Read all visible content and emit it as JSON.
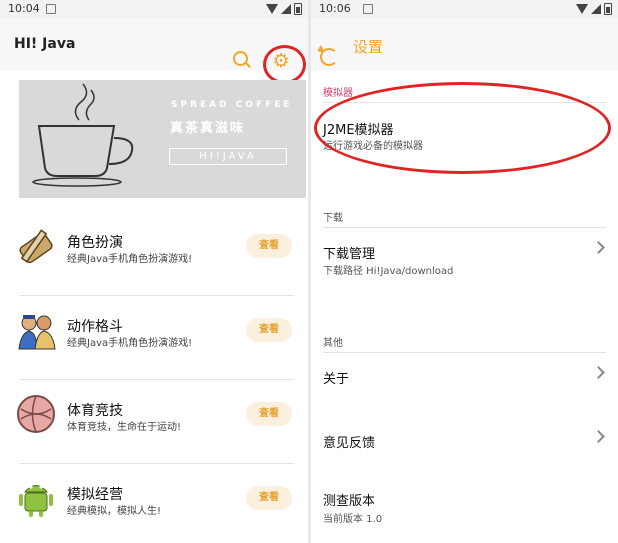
{
  "left": {
    "status": {
      "time": "10:04"
    },
    "appbar": {
      "title": "HI! Java",
      "search_icon": "search-icon",
      "settings_icon": "gear-icon"
    },
    "banner": {
      "line1": "SPREAD COFFEE",
      "line2": "真茶真滋味",
      "line3": "HI!JAVA"
    },
    "games": [
      {
        "name": "角色扮演",
        "desc": "经典Java手机角色扮演游戏!",
        "button": "查看"
      },
      {
        "name": "动作格斗",
        "desc": "经典Java手机角色扮演游戏!",
        "button": "查看"
      },
      {
        "name": "体育竞技",
        "desc": "体育竞技，生命在于运动!",
        "button": "查看"
      },
      {
        "name": "模拟经营",
        "desc": "经典模拟，模拟人生!",
        "button": "查看"
      }
    ]
  },
  "right": {
    "status": {
      "time": "10:06"
    },
    "appbar": {
      "title": "设置",
      "back_icon": "back-icon"
    },
    "sections": [
      {
        "header": "模拟器",
        "items": [
          {
            "title": "J2ME模拟器",
            "summary": "运行游戏必备的模拟器"
          }
        ]
      },
      {
        "header": "下载",
        "items": [
          {
            "title": "下载管理",
            "summary": "下载路径 Hi!Java/download"
          }
        ]
      },
      {
        "header": "其他",
        "items": [
          {
            "title": "关于",
            "summary": ""
          },
          {
            "title": "意见反馈",
            "summary": ""
          },
          {
            "title": "测查版本",
            "summary": "当前版本 1.0"
          }
        ]
      }
    ]
  },
  "colors": {
    "accent": "#f1a62b",
    "highlight_circle": "#e02424",
    "section_accent": "#d13b6b"
  }
}
